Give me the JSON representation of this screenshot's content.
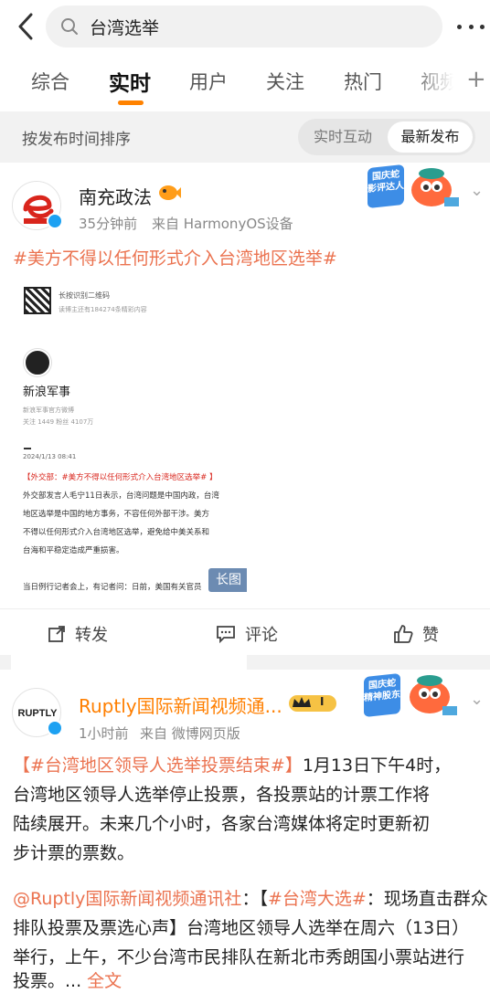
{
  "search": {
    "query": "台湾选举"
  },
  "tabs": [
    {
      "label": "综合"
    },
    {
      "label": "实时"
    },
    {
      "label": "用户"
    },
    {
      "label": "关注"
    },
    {
      "label": "热门"
    },
    {
      "label": "视频"
    }
  ],
  "sort": {
    "label": "按发布时间排序",
    "options": [
      "实时互动",
      "最新发布"
    ],
    "selected": "最新发布"
  },
  "posts": [
    {
      "author": "南充政法",
      "time": "35分钟前",
      "source": "来自 HarmonyOS设备",
      "badge_text": "国庆蛇 影评达人",
      "text_lines": [
        "#美方不得以任何形式介入台湾地区选举#"
      ],
      "image": {
        "qr_line1": "长按识别二维码",
        "qr_line2": "读博主还有184274条精彩内容",
        "account": "新浪军事",
        "account_desc": "新浪军事官方微博",
        "stats": "关注 1449    粉丝 4107万",
        "date": "2024/1/13 08:41",
        "body": [
          "【外交部：#美方不得以任何形式介入台湾地区选举# 】",
          "外交部发言人毛宁11日表示，台湾问题是中国内政，台湾",
          "地区选举是中国的地方事务，不容任何外部干涉。美方",
          "不得以任何形式介入台湾地区选举，避免给中美关系和",
          "台海和平稳定造成严重损害。",
          "当日例行记者会上，有记者问：日前，美国有关官员"
        ],
        "tag": "长图"
      },
      "actions": {
        "repost": "转发",
        "comment": "评论",
        "like": "赞"
      }
    },
    {
      "author": "Ruptly国际新闻视频通...",
      "avatar_text": "RUPTLY",
      "level": "I",
      "time": "1小时前",
      "source": "来自 微博网页版",
      "badge_text": "国庆蛇 精神股东",
      "para1": {
        "topic": "【#台湾地区领导人选举投票结束#】",
        "line1_rest": "1月13日下午4时，",
        "line2": "台湾地区领导人选举停止投票，各投票站的计票工作将",
        "line3": "陆续展开。未来几个小时，各家台湾媒体将定时更新初",
        "line4": "步计票的票数。"
      },
      "para2": {
        "mention": "@Ruptly国际新闻视频通讯社",
        "sep": "：【",
        "topic": "#台湾大选#",
        "line1_rest": "：现场直击群众",
        "line2": "排队投票及票选心声】台湾地区领导人选举在周六（13日）",
        "line3": "举行，上午，不少台湾市民排队在新北市秀朗国小票站进行",
        "line4": "投票。...",
        "full_text": "全文"
      }
    }
  ]
}
